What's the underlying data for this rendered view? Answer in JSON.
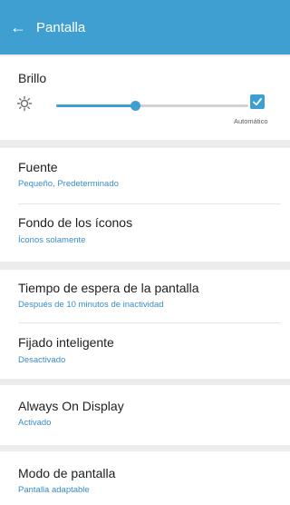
{
  "appbar": {
    "title": "Pantalla",
    "back_icon": "arrow-left-icon"
  },
  "brightness": {
    "label": "Brillo",
    "level": 0.41,
    "auto_label": "Automático",
    "auto_checked": true,
    "icon": "sun-icon"
  },
  "settings": {
    "font": {
      "title": "Fuente",
      "value": "Pequeño, Predeterminado"
    },
    "icon_bg": {
      "title": "Fondo de los íconos",
      "value": "Íconos solamente"
    },
    "timeout": {
      "title": "Tiempo de espera de la pantalla",
      "value": "Después de 10 minutos de inactividad"
    },
    "smart_stay": {
      "title": "Fijado inteligente",
      "value": "Desactivado"
    },
    "aod": {
      "title": "Always On Display",
      "value": "Activado"
    },
    "screen_mode": {
      "title": "Modo de pantalla",
      "value": "Pantalla adaptable"
    }
  },
  "colors": {
    "accent": "#3f9fd0",
    "background": "#ececec"
  }
}
